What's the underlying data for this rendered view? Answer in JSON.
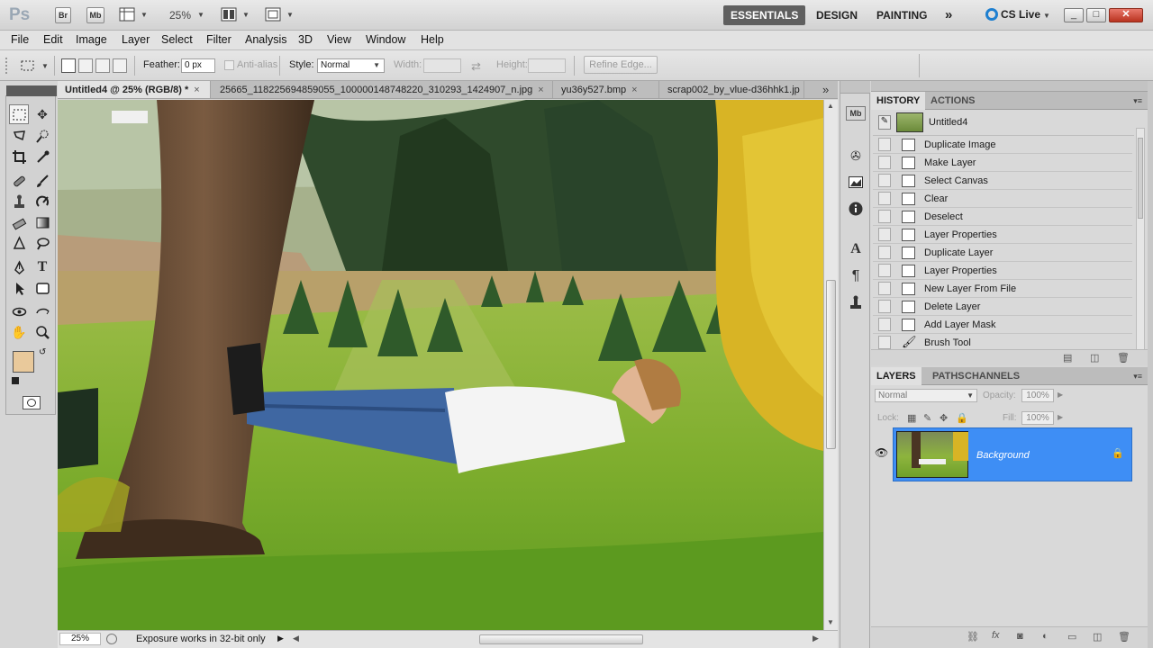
{
  "appbar": {
    "app_logo": "Ps",
    "bridge": "Br",
    "minibridge": "Mb",
    "zoom": "25%",
    "workspaces": [
      "ESSENTIALS",
      "DESIGN",
      "PAINTING"
    ],
    "more": "»",
    "cs_live": "CS Live",
    "accent_color": "#1e7fd0"
  },
  "menu": [
    "File",
    "Edit",
    "Image",
    "Layer",
    "Select",
    "Filter",
    "Analysis",
    "3D",
    "View",
    "Window",
    "Help"
  ],
  "options": {
    "feather_label": "Feather:",
    "feather_value": "0 px",
    "antialias": "Anti-alias",
    "style_label": "Style:",
    "style_value": "Normal",
    "width_label": "Width:",
    "height_label": "Height:",
    "refine_edge": "Refine Edge..."
  },
  "tabs": [
    {
      "label": "Untitled4 @ 25% (RGB/8) *",
      "close": "×"
    },
    {
      "label": "25665_118225694859055_100000148748220_310293_1424907_n.jpg",
      "close": "×"
    },
    {
      "label": "yu36y527.bmp",
      "close": "×"
    },
    {
      "label": "scrap002_by_vlue-d36hhk1.jp",
      "close": ""
    }
  ],
  "tabs_more": "»",
  "status": {
    "zoom": "25%",
    "message": "Exposure works in 32-bit only"
  },
  "colors": {
    "foreground": "#e9c99b",
    "background": "#ffffff",
    "layer_selected": "#3e8ef5"
  },
  "history": {
    "tabs": [
      "HISTORY",
      "ACTIONS"
    ],
    "snapshot": "Untitled4",
    "items": [
      "Duplicate Image",
      "Make Layer",
      "Select Canvas",
      "Clear",
      "Deselect",
      "Layer Properties",
      "Duplicate Layer",
      "Layer Properties",
      "New Layer From File",
      "Delete Layer",
      "Add Layer Mask",
      "Brush Tool"
    ]
  },
  "layers": {
    "tabs": [
      "LAYERS",
      "PATHS",
      "CHANNELS"
    ],
    "blend_mode": "Normal",
    "opacity_label": "Opacity:",
    "opacity": "100%",
    "lock_label": "Lock:",
    "fill_label": "Fill:",
    "fill": "100%",
    "items": [
      {
        "name": "Background"
      }
    ]
  }
}
